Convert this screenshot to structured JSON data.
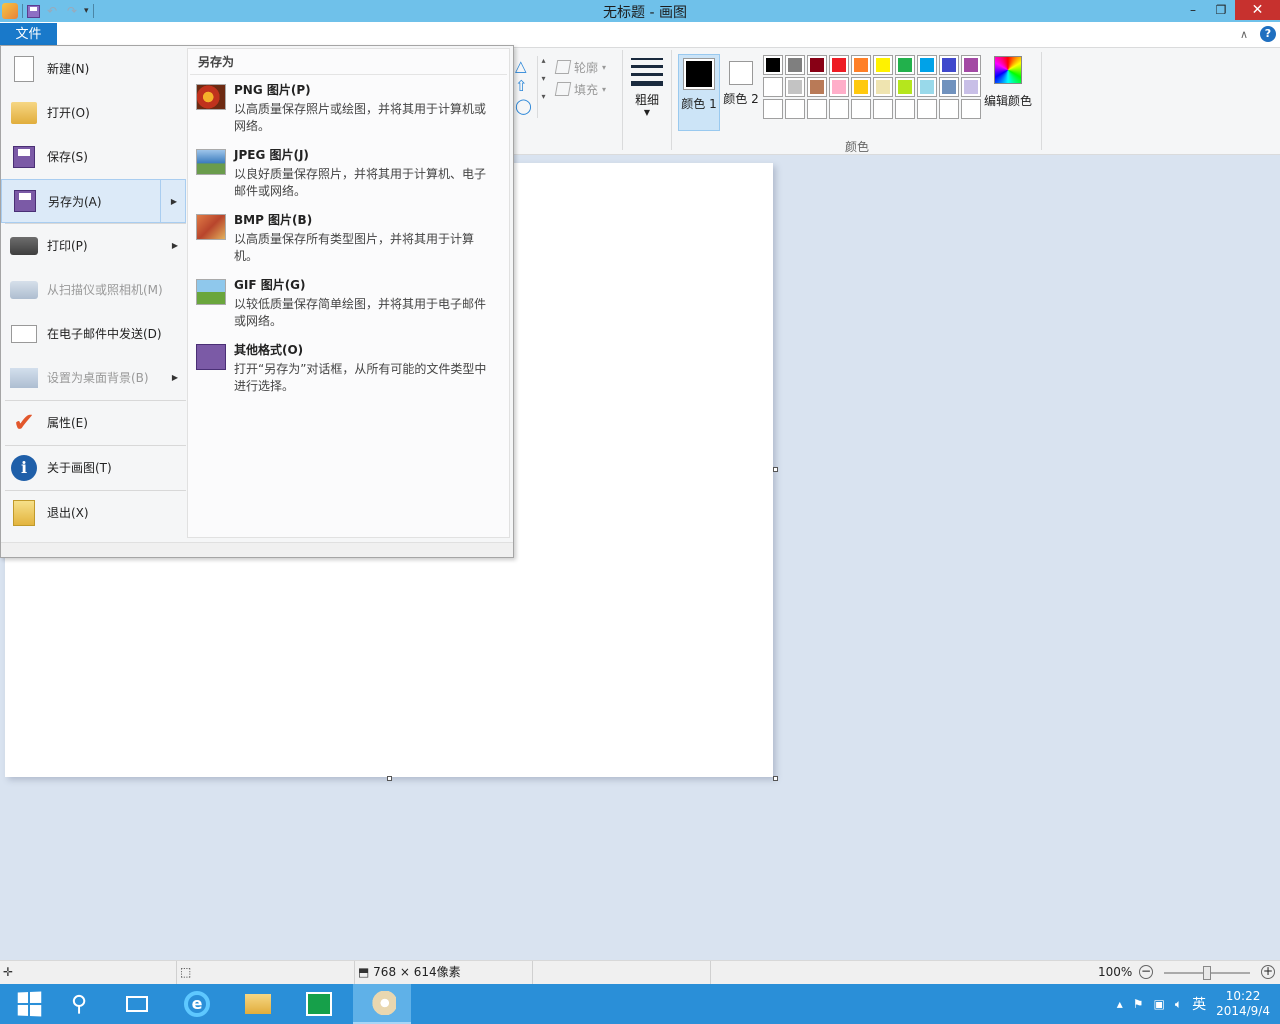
{
  "window": {
    "title": "无标题 - 画图",
    "minimize": "–",
    "restore": "❐",
    "close": "✕"
  },
  "qat": {
    "undo": "↶",
    "redo": "↷",
    "dropdown": "▾"
  },
  "ribbon": {
    "file_tab": "文件",
    "collapse": "∧",
    "help": "?",
    "outline_label": "轮廓",
    "fill_label": "填充",
    "thickness_label": "粗细",
    "color1_label": "颜色 1",
    "color2_label": "颜色 2",
    "edit_colors_label": "编辑颜色",
    "colors_group_label": "颜色",
    "color1": "#000000",
    "color2": "#ffffff",
    "palette": [
      "#000000",
      "#7f7f7f",
      "#880015",
      "#ed1c24",
      "#ff7f27",
      "#fff200",
      "#22b14c",
      "#00a2e8",
      "#3f48cc",
      "#a349a4",
      "#ffffff",
      "#c3c3c3",
      "#b97a57",
      "#ffaec9",
      "#ffc90e",
      "#efe4b0",
      "#b5e61d",
      "#99d9ea",
      "#7092be",
      "#c8bfe7",
      "#ffffff",
      "#ffffff",
      "#ffffff",
      "#ffffff",
      "#ffffff",
      "#ffffff",
      "#ffffff",
      "#ffffff",
      "#ffffff",
      "#ffffff"
    ]
  },
  "file_menu": {
    "items": [
      {
        "label": "新建(N)",
        "icon": "new-doc-icon"
      },
      {
        "label": "打开(O)",
        "icon": "open-folder-icon"
      },
      {
        "label": "保存(S)",
        "icon": "save-icon"
      },
      {
        "label": "另存为(A)",
        "icon": "save-as-icon",
        "active": true,
        "submenu": true
      },
      {
        "label": "打印(P)",
        "icon": "printer-icon",
        "submenu": true
      },
      {
        "label": "从扫描仪或照相机(M)",
        "icon": "scanner-icon",
        "disabled": true
      },
      {
        "label": "在电子邮件中发送(D)",
        "icon": "email-icon"
      },
      {
        "label": "设置为桌面背景(B)",
        "icon": "desktop-icon",
        "disabled": true,
        "submenu": true
      },
      {
        "label": "属性(E)",
        "icon": "checkmark-icon"
      },
      {
        "label": "关于画图(T)",
        "icon": "info-icon"
      },
      {
        "label": "退出(X)",
        "icon": "exit-icon"
      }
    ],
    "save_as": {
      "header": "另存为",
      "options": [
        {
          "title": "PNG 图片(P)",
          "desc": "以高质量保存照片或绘图，并将其用于计算机或网络。"
        },
        {
          "title": "JPEG 图片(J)",
          "desc": "以良好质量保存照片，并将其用于计算机、电子邮件或网络。"
        },
        {
          "title": "BMP 图片(B)",
          "desc": "以高质量保存所有类型图片，并将其用于计算机。"
        },
        {
          "title": "GIF 图片(G)",
          "desc": "以较低质量保存简单绘图，并将其用于电子邮件或网络。"
        },
        {
          "title": "其他格式(O)",
          "desc": "打开“另存为”对话框，从所有可能的文件类型中进行选择。"
        }
      ]
    }
  },
  "statusbar": {
    "canvas_size": "768 × 614像素",
    "zoom": "100%",
    "zoom_level": 1.0
  },
  "taskbar": {
    "ime": "英",
    "time": "10:22",
    "date": "2014/9/4"
  }
}
